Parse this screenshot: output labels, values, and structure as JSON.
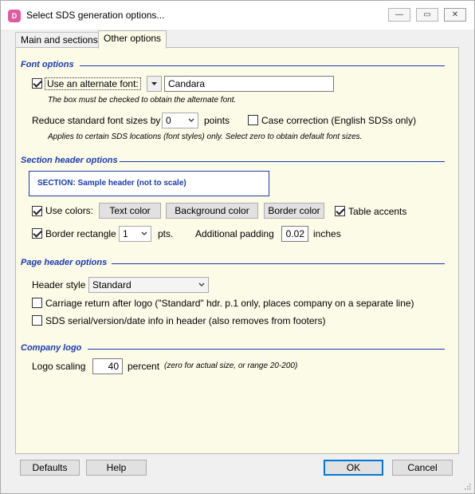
{
  "window": {
    "title": "Select SDS generation options...",
    "app_icon_text": "D",
    "accent_color": "#1a3bb0"
  },
  "titlebar_buttons": {
    "minimize": "—",
    "maximize": "▭",
    "close": "✕"
  },
  "tabs": [
    {
      "label": "Main and sections",
      "active": false
    },
    {
      "label": "Other options",
      "active": true
    }
  ],
  "font_options": {
    "section_title": "Font options",
    "alt_font_checkbox_label": "Use an alternate font:",
    "alt_font_checked": true,
    "alt_font_value": "Candara",
    "alt_font_note": "The box must be checked to obtain the alternate font.",
    "reduce_label": "Reduce standard font sizes by",
    "reduce_value": "0",
    "reduce_unit": "points",
    "case_correction_label": "Case correction (English SDSs only)",
    "case_correction_checked": false,
    "reduce_note": "Applies to certain SDS locations (font styles) only. Select zero to obtain default font sizes."
  },
  "section_header_options": {
    "section_title": "Section header options",
    "sample_text": "SECTION: Sample header (not to scale)",
    "use_colors_label": "Use colors:",
    "use_colors_checked": true,
    "text_color_button": "Text color",
    "background_color_button": "Background color",
    "border_color_button": "Border color",
    "table_accents_label": "Table accents",
    "table_accents_checked": true,
    "border_rect_label": "Border rectangle",
    "border_rect_checked": true,
    "border_rect_value": "1",
    "border_rect_unit": "pts.",
    "padding_label": "Additional padding",
    "padding_value": "0.02",
    "padding_unit": "inches"
  },
  "page_header_options": {
    "section_title": "Page header options",
    "header_style_label": "Header style",
    "header_style_value": "Standard",
    "carriage_return_label": "Carriage return after logo (\"Standard\" hdr. p.1 only, places company on a separate line)",
    "carriage_return_checked": false,
    "serial_info_label": "SDS serial/version/date info in header (also removes from footers)",
    "serial_info_checked": false
  },
  "company_logo": {
    "section_title": "Company logo",
    "logo_scaling_label": "Logo scaling",
    "logo_scaling_value": "40",
    "logo_scaling_unit": "percent",
    "logo_scaling_note": "(zero for actual size, or range 20-200)"
  },
  "footer_buttons": {
    "defaults": "Defaults",
    "help": "Help",
    "ok": "OK",
    "cancel": "Cancel"
  }
}
